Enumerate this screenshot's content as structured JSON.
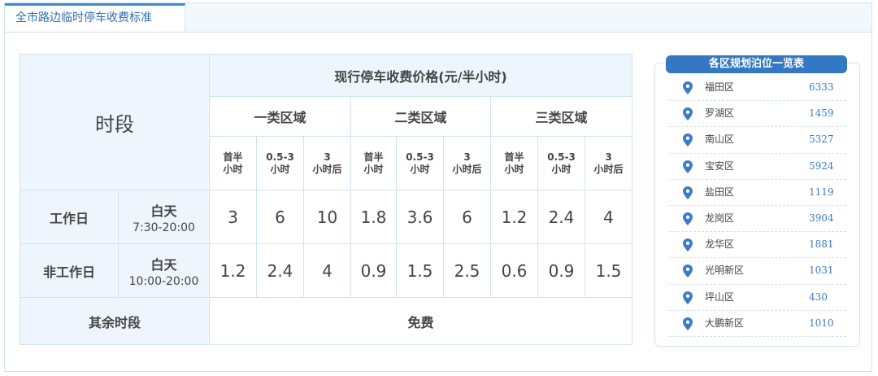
{
  "tab": {
    "label": "全市路边临时停车收费标准"
  },
  "fee_table": {
    "period_header": "时段",
    "price_header": "现行停车收费价格(元/半小时)",
    "zones": [
      "一类区域",
      "二类区域",
      "三类区域"
    ],
    "sub_headers": [
      [
        "首半",
        "小时"
      ],
      [
        "0.5-3",
        "小时"
      ],
      [
        "3",
        "小时后"
      ],
      [
        "首半",
        "小时"
      ],
      [
        "0.5-3",
        "小时"
      ],
      [
        "3",
        "小时后"
      ],
      [
        "首半",
        "小时"
      ],
      [
        "0.5-3",
        "小时"
      ],
      [
        "3",
        "小时后"
      ]
    ],
    "rows": [
      {
        "label": "工作日",
        "time_label": "白天",
        "time_range": "7:30-20:00",
        "values": [
          "3",
          "6",
          "10",
          "1.8",
          "3.6",
          "6",
          "1.2",
          "2.4",
          "4"
        ]
      },
      {
        "label": "非工作日",
        "time_label": "白天",
        "time_range": "10:00-20:00",
        "values": [
          "1.2",
          "2.4",
          "4",
          "0.9",
          "1.5",
          "2.5",
          "0.6",
          "0.9",
          "1.5"
        ]
      }
    ],
    "other": {
      "label": "其余时段",
      "value": "免费"
    }
  },
  "districts": {
    "title": "各区规划泊位一览表",
    "icon": "map-pin-icon",
    "pin_color": "#3b7ac8",
    "items": [
      {
        "name": "福田区",
        "count": "6333"
      },
      {
        "name": "罗湖区",
        "count": "1459"
      },
      {
        "name": "南山区",
        "count": "5327"
      },
      {
        "name": "宝安区",
        "count": "5924"
      },
      {
        "name": "盐田区",
        "count": "1119"
      },
      {
        "name": "龙岗区",
        "count": "3904"
      },
      {
        "name": "龙华区",
        "count": "1881"
      },
      {
        "name": "光明新区",
        "count": "1031"
      },
      {
        "name": "坪山区",
        "count": "430"
      },
      {
        "name": "大鹏新区",
        "count": "1010"
      }
    ]
  }
}
